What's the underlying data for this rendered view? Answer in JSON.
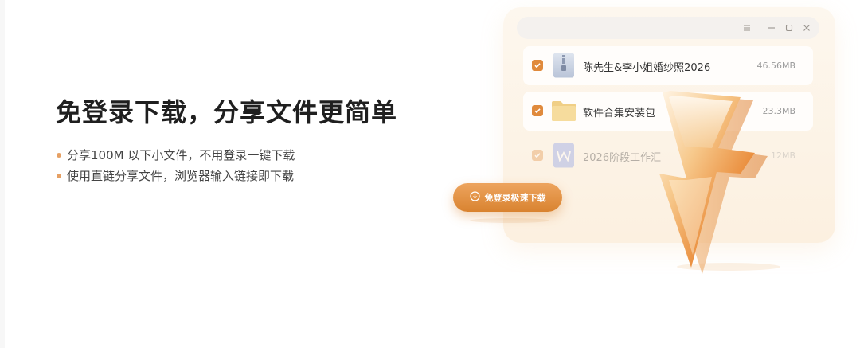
{
  "hero": {
    "title": "免登录下载，分享文件更简单",
    "features": [
      "分享100M 以下小文件，不用登录一键下载",
      "使用直链分享文件，浏览器输入链接即下载"
    ]
  },
  "cta": {
    "label": "免登录极速下载",
    "icon": "download-icon"
  },
  "window": {
    "controls": [
      "menu-icon",
      "minimize-icon",
      "maximize-icon",
      "close-icon"
    ],
    "files": [
      {
        "name": "陈先生&李小姐婚纱照2026",
        "size": "46.56MB",
        "checked": true,
        "icon": "zip-file-icon"
      },
      {
        "name": "软件合集安装包",
        "size": "23.3MB",
        "checked": true,
        "icon": "folder-icon"
      },
      {
        "name": "2026阶段工作汇",
        "size": "12MB",
        "checked": true,
        "icon": "word-doc-icon"
      }
    ]
  },
  "colors": {
    "accent": "#e08a3c",
    "accent_light": "#eda45e",
    "panel_bg": "#fdf7ee",
    "title_text": "#1f1f1f",
    "body_text": "#444444",
    "bullet": "#e6a064"
  }
}
